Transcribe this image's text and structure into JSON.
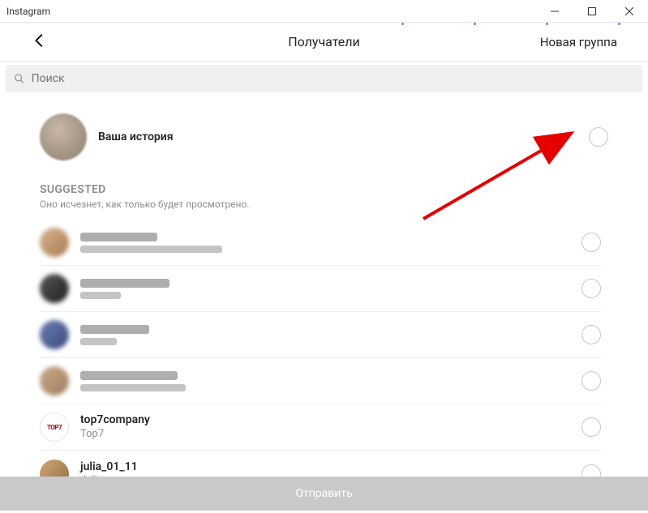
{
  "app_title": "Instagram",
  "topbar": {
    "title": "Получатели",
    "new_group": "Новая группа"
  },
  "search": {
    "placeholder": "Поиск"
  },
  "story": {
    "label": "Ваша история"
  },
  "suggested": {
    "title": "SUGGESTED",
    "subtitle": "Оно исчезнет, как только будет просмотрено."
  },
  "rows": {
    "top7": {
      "name": "top7company",
      "sub": "Top7",
      "logo": "TOP7"
    },
    "julia": {
      "name": "julia_01_11",
      "sub": "Julia"
    }
  },
  "send": {
    "label": "Отправить"
  }
}
